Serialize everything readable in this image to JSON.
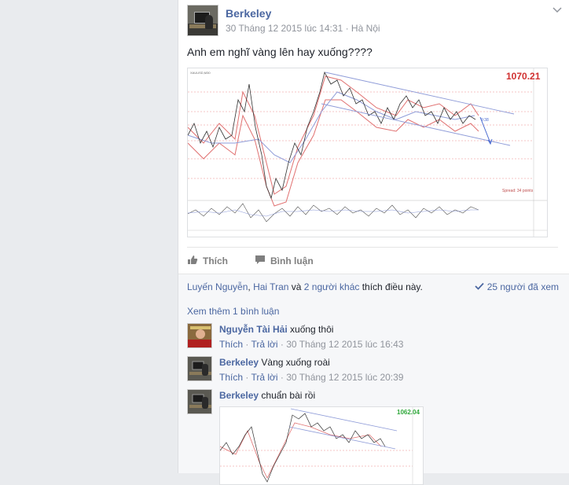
{
  "post": {
    "author": "Berkeley",
    "meta": "30 Tháng 12 2015 lúc 14:31 · Hà Nội",
    "text": "Anh em nghĩ vàng lên hay xuống????",
    "chart_price_label": "1070.21",
    "chart_mini_label": "9:38",
    "chart_spread_label": "Spread: 34 points"
  },
  "actions": {
    "like_label": "Thích",
    "comment_label": "Bình luận"
  },
  "likes": {
    "name1": "Luyến Nguyễn",
    "sep": ", ",
    "name2": "Hai Tran",
    "and": " và ",
    "others": "2 người khác",
    "suffix": " thích điều này.",
    "seen": "25 người đã xem"
  },
  "comments": {
    "more_label": "Xem thêm 1 bình luận",
    "items": [
      {
        "name": "Nguyễn Tài Hải",
        "text": "xuống thôi",
        "like": "Thích",
        "reply": "Trả lời",
        "time": "30 Tháng 12 2015 lúc 16:43"
      },
      {
        "name": "Berkeley",
        "text": "Vàng xuống roài",
        "like": "Thích",
        "reply": "Trả lời",
        "time": "30 Tháng 12 2015 lúc 20:39"
      },
      {
        "name": "Berkeley",
        "text": "chuẩn bài rồi",
        "chart_price_label": "1062.04"
      }
    ]
  },
  "colors": {
    "link": "#4b67a1",
    "price": "#d03030",
    "price_green": "#2fa83a",
    "channel": "#8e9bd8"
  }
}
